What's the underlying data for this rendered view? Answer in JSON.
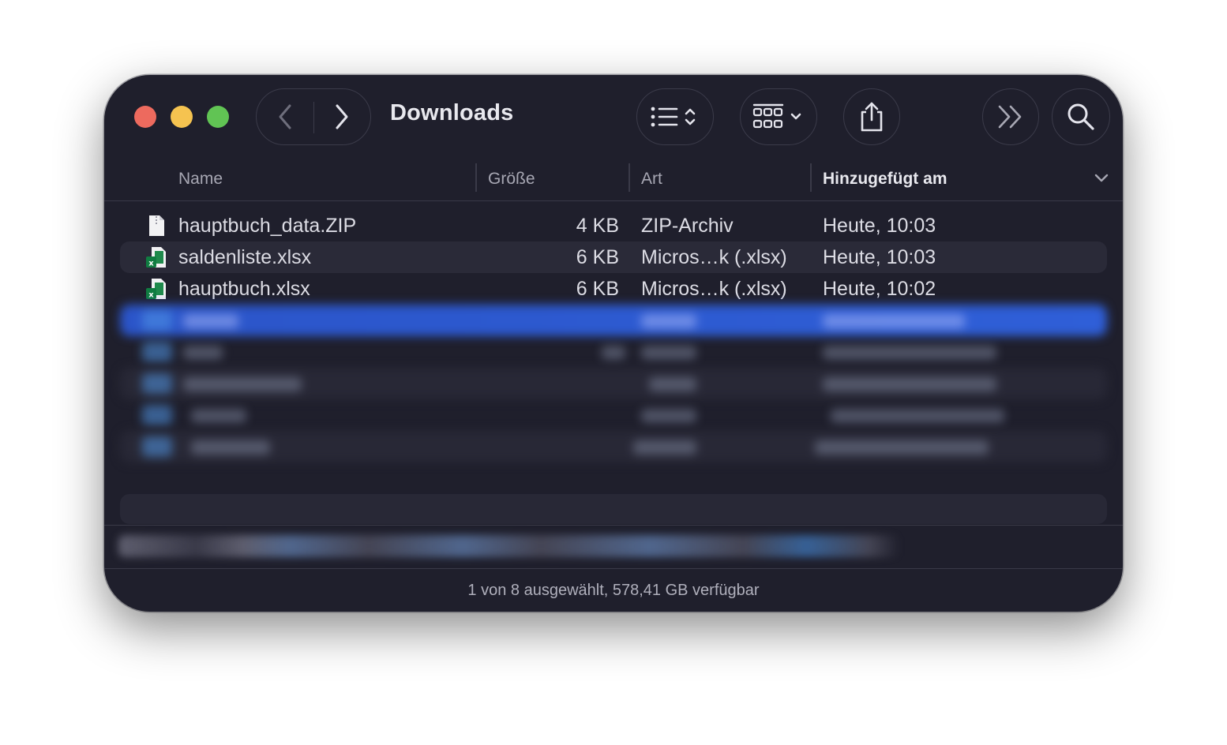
{
  "window": {
    "title": "Downloads"
  },
  "toolbar": {
    "back_icon": "chevron-left-icon",
    "forward_icon": "chevron-right-icon",
    "list_view_icon": "list-sort-icon",
    "group_view_icon": "grid-group-icon",
    "share_icon": "share-icon",
    "more_icon": "double-chevron-right-icon",
    "search_icon": "magnifier-icon"
  },
  "columns": {
    "name": "Name",
    "size": "Größe",
    "kind": "Art",
    "date_added": "Hinzugefügt am"
  },
  "files": [
    {
      "name": "hauptbuch_data.ZIP",
      "size": "4 KB",
      "kind": "ZIP-Archiv",
      "date": "Heute, 10:03",
      "icon": "zip-file-icon"
    },
    {
      "name": "saldenliste.xlsx",
      "size": "6 KB",
      "kind": "Micros…k (.xlsx)",
      "date": "Heute, 10:03",
      "icon": "excel-file-icon"
    },
    {
      "name": "hauptbuch.xlsx",
      "size": "6 KB",
      "kind": "Micros…k (.xlsx)",
      "date": "Heute, 10:02",
      "icon": "excel-file-icon"
    }
  ],
  "status": {
    "text": "1 von 8 ausgewählt, 578,41 GB verfügbar"
  },
  "colors": {
    "window_bg": "#1f1f2c",
    "selection": "#2f5fd8",
    "traffic_red": "#ed6a5e",
    "traffic_yellow": "#f5c350",
    "traffic_green": "#61c454"
  }
}
